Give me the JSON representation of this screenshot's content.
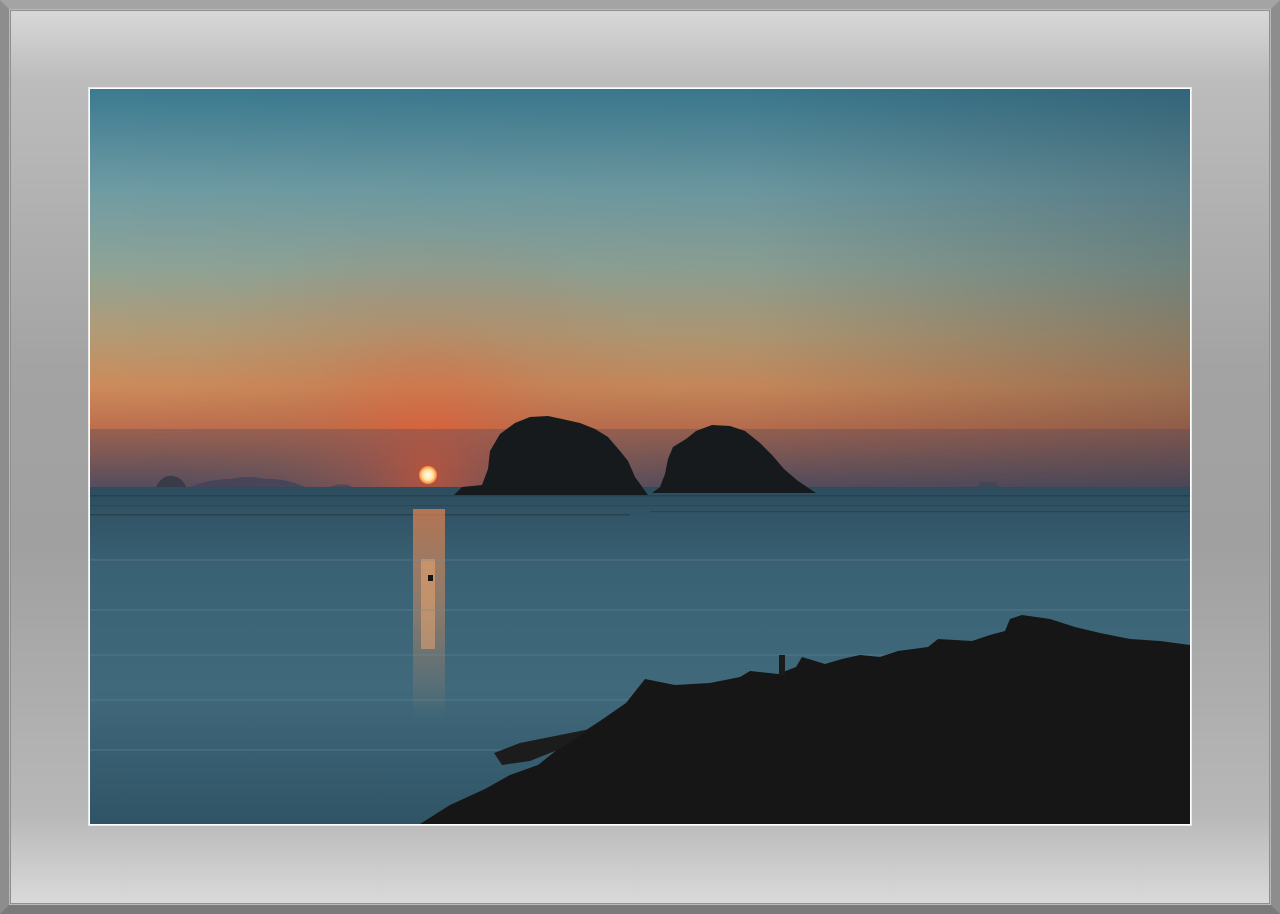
{
  "image": {
    "subject": "sunset-over-sea-with-islands",
    "colors": {
      "frame": "#a0a0a0",
      "sky_top": "#3e7c90",
      "sky_mid": "#8ea49b",
      "sky_horizon": "#d27a4a",
      "sun": "#fff2c8",
      "sea": "#3c6476",
      "rocks": "#141414"
    }
  }
}
